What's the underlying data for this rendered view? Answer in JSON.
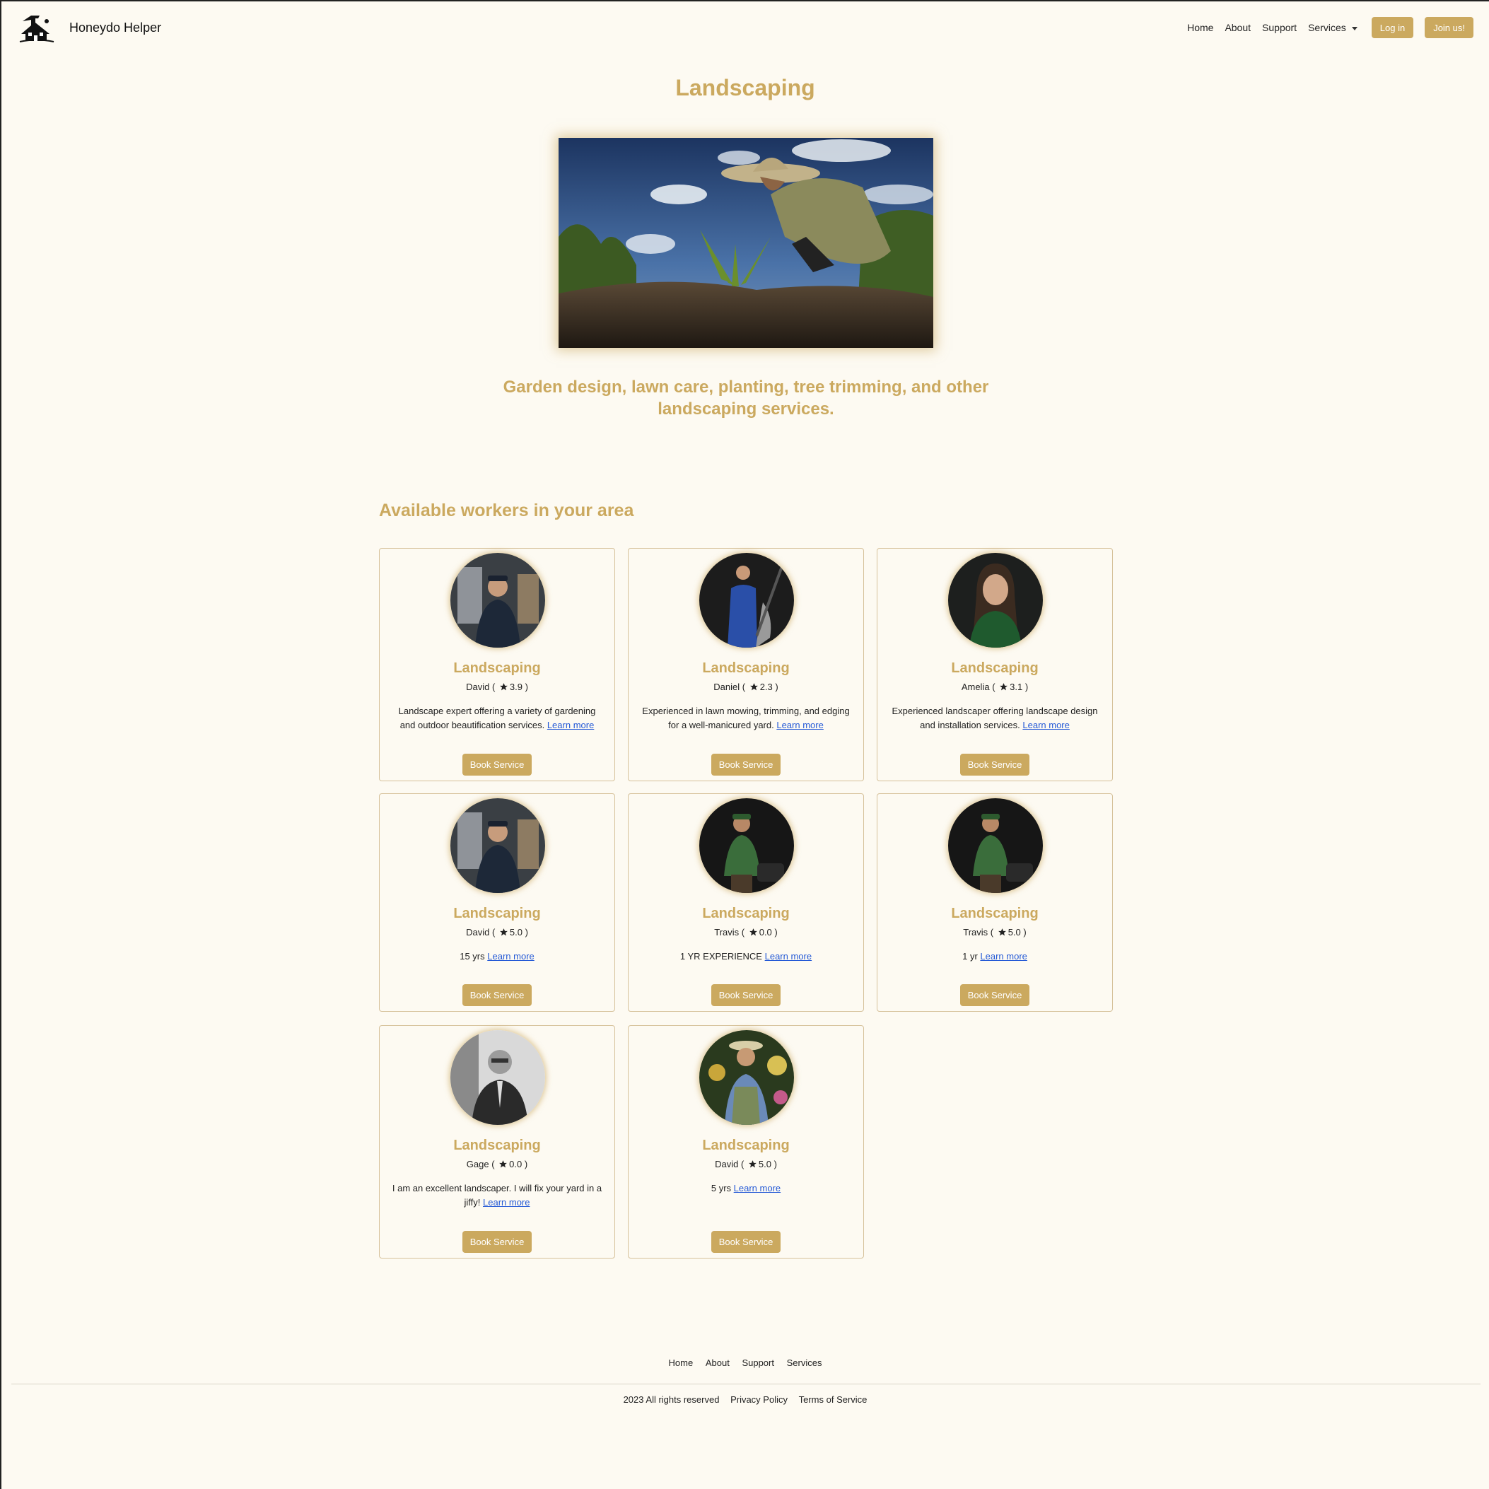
{
  "brand": {
    "name": "Honeydo Helper"
  },
  "nav": {
    "home": "Home",
    "about": "About",
    "support": "Support",
    "services": "Services",
    "login": "Log in",
    "join": "Join us!"
  },
  "hero": {
    "title": "Landscaping",
    "description": "Garden design, lawn care, planting, tree trimming, and other landscaping services."
  },
  "section": {
    "title": "Available workers in your area"
  },
  "learn_more": "Learn more",
  "book_label": "Book Service",
  "workers": [
    {
      "category": "Landscaping",
      "name": "David",
      "rating": "3.9",
      "description": "Landscape expert offering a variety of gardening and outdoor beautification services."
    },
    {
      "category": "Landscaping",
      "name": "Daniel",
      "rating": "2.3",
      "description": "Experienced in lawn mowing, trimming, and edging for a well-manicured yard."
    },
    {
      "category": "Landscaping",
      "name": "Amelia",
      "rating": "3.1",
      "description": "Experienced landscaper offering landscape design and installation services."
    },
    {
      "category": "Landscaping",
      "name": "David",
      "rating": "5.0",
      "description": "15 yrs"
    },
    {
      "category": "Landscaping",
      "name": "Travis",
      "rating": "0.0",
      "description": "1 YR EXPERIENCE"
    },
    {
      "category": "Landscaping",
      "name": "Travis",
      "rating": "5.0",
      "description": "1 yr"
    },
    {
      "category": "Landscaping",
      "name": "Gage",
      "rating": "0.0",
      "description": "I am an excellent landscaper. I will fix your yard in a jiffy!"
    },
    {
      "category": "Landscaping",
      "name": "David",
      "rating": "5.0",
      "description": "5 yrs"
    }
  ],
  "footer": {
    "home": "Home",
    "about": "About",
    "support": "Support",
    "services": "Services",
    "copyright": "2023 All rights reserved",
    "privacy": "Privacy Policy",
    "terms": "Terms of Service"
  },
  "colors": {
    "accent": "#cba95f",
    "background": "#fdfaf2",
    "link": "#2459d6"
  }
}
